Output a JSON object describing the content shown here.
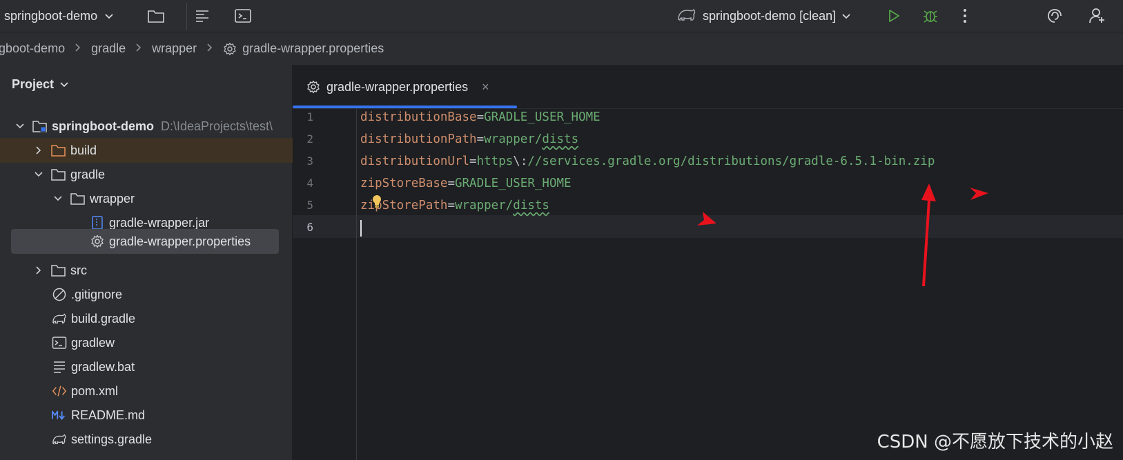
{
  "toolbar": {
    "project_name": "springboot-demo",
    "run_config": "springboot-demo [clean]",
    "icons": [
      "folder-icon",
      "structure-icon",
      "terminal-icon",
      "gradle-icon",
      "run-icon",
      "debug-icon",
      "more-icon",
      "ai-assistant-icon",
      "add-user-icon"
    ],
    "colors": {
      "run": "#57a64a",
      "debug": "#57a64a"
    }
  },
  "breadcrumb": {
    "items": [
      "ngboot-demo",
      "gradle",
      "wrapper",
      "gradle-wrapper.properties"
    ]
  },
  "project_panel": {
    "title": "Project",
    "tree": [
      {
        "label": "springboot-demo",
        "path": "D:\\IdeaProjects\\test\\",
        "icon": "module-folder-icon",
        "expanded": true
      },
      {
        "label": "build",
        "icon": "folder-icon",
        "expanded": false
      },
      {
        "label": "gradle",
        "icon": "folder-icon",
        "expanded": true
      },
      {
        "label": "wrapper",
        "icon": "folder-icon",
        "expanded": true
      },
      {
        "label": "gradle-wrapper.jar",
        "icon": "jar-file-icon"
      },
      {
        "label": "gradle-wrapper.properties",
        "icon": "properties-gear-icon",
        "selected": true
      },
      {
        "label": "src",
        "icon": "folder-icon",
        "expanded": false
      },
      {
        "label": ".gitignore",
        "icon": "ignore-file-icon"
      },
      {
        "label": "build.gradle",
        "icon": "gradle-elephant-icon"
      },
      {
        "label": "gradlew",
        "icon": "shell-script-icon"
      },
      {
        "label": "gradlew.bat",
        "icon": "text-file-icon"
      },
      {
        "label": "pom.xml",
        "icon": "xml-file-icon"
      },
      {
        "label": "README.md",
        "icon": "markdown-file-icon"
      },
      {
        "label": "settings.gradle",
        "icon": "gradle-elephant-icon"
      }
    ]
  },
  "editor": {
    "tab_label": "gradle-wrapper.properties",
    "tab_close": "×",
    "line_numbers": [
      "1",
      "2",
      "3",
      "4",
      "5",
      "6"
    ],
    "lines": [
      {
        "key": "distributionBase",
        "eq": "=",
        "value": "GRADLE_USER_HOME"
      },
      {
        "key": "distributionPath",
        "eq": "=",
        "value_a": "wrapper/",
        "value_b": "dists"
      },
      {
        "key": "distributionUrl",
        "eq": "=",
        "value_a": "https",
        "escape": "\\:",
        "value_b": "//services.gradle.org/distributions/gradle-6.5.1-bin.zip"
      },
      {
        "key": "zipStoreBase",
        "eq": "=",
        "value": "GRADLE_USER_HOME"
      },
      {
        "key": "zipStorePath",
        "eq": "=",
        "value_a": "wrapper/",
        "value_b": "dists"
      }
    ]
  },
  "watermark": "CSDN @不愿放下技术的小赵"
}
